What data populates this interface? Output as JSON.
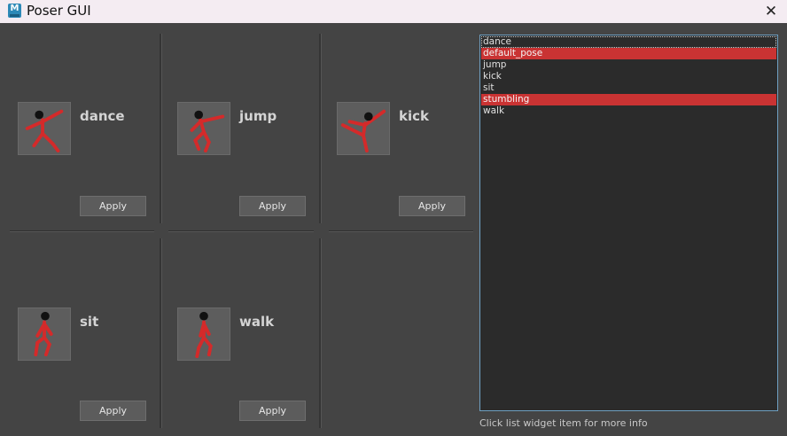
{
  "window": {
    "title": "Poser GUI",
    "app_icon_letter": "M",
    "close_glyph": "✕"
  },
  "poses": [
    {
      "name": "dance",
      "apply_label": "Apply",
      "icon": "dance-figure-icon"
    },
    {
      "name": "jump",
      "apply_label": "Apply",
      "icon": "jump-figure-icon"
    },
    {
      "name": "kick",
      "apply_label": "Apply",
      "icon": "kick-figure-icon"
    },
    {
      "name": "sit",
      "apply_label": "Apply",
      "icon": "sit-figure-icon"
    },
    {
      "name": "walk",
      "apply_label": "Apply",
      "icon": "walk-figure-icon"
    }
  ],
  "pose_list": {
    "items": [
      "dance",
      "default_pose",
      "jump",
      "kick",
      "sit",
      "stumbling",
      "walk"
    ],
    "selected": [
      "default_pose",
      "stumbling"
    ],
    "current": "dance"
  },
  "status": {
    "text": "Click list widget item for more info"
  },
  "colors": {
    "background": "#444444",
    "selection": "#c93333",
    "figure": "#d42a2a",
    "list_background": "#2b2b2b",
    "list_border": "#6fa0c2"
  }
}
